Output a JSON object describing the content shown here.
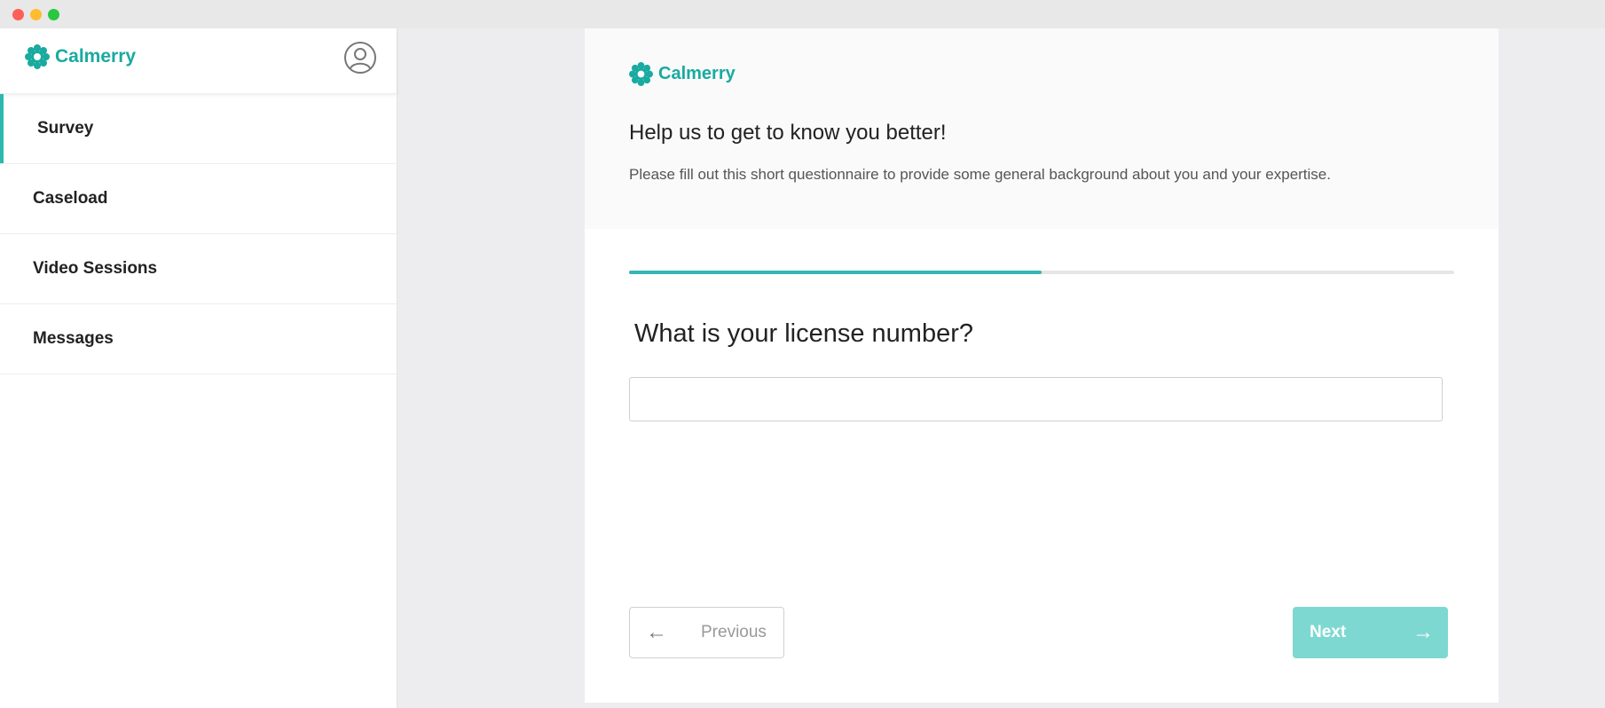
{
  "brand": {
    "name": "Calmerry",
    "color": "#19aaa0"
  },
  "sidebar": {
    "items": [
      {
        "label": "Survey",
        "active": true
      },
      {
        "label": "Caseload"
      },
      {
        "label": "Video Sessions"
      },
      {
        "label": "Messages"
      }
    ],
    "avatar_icon": "user-circle-icon"
  },
  "survey": {
    "title": "Help us to get to know you better!",
    "description": "Please fill out this short questionnaire to provide some general background about you and your expertise.",
    "progress": 0.5,
    "question": "What is your license number?",
    "answer_value": "",
    "previous_label": "Previous",
    "next_label": "Next"
  },
  "colors": {
    "accent": "#2bb9ad",
    "progress": "#36b5b7",
    "next_button": "#7ed8d2"
  }
}
